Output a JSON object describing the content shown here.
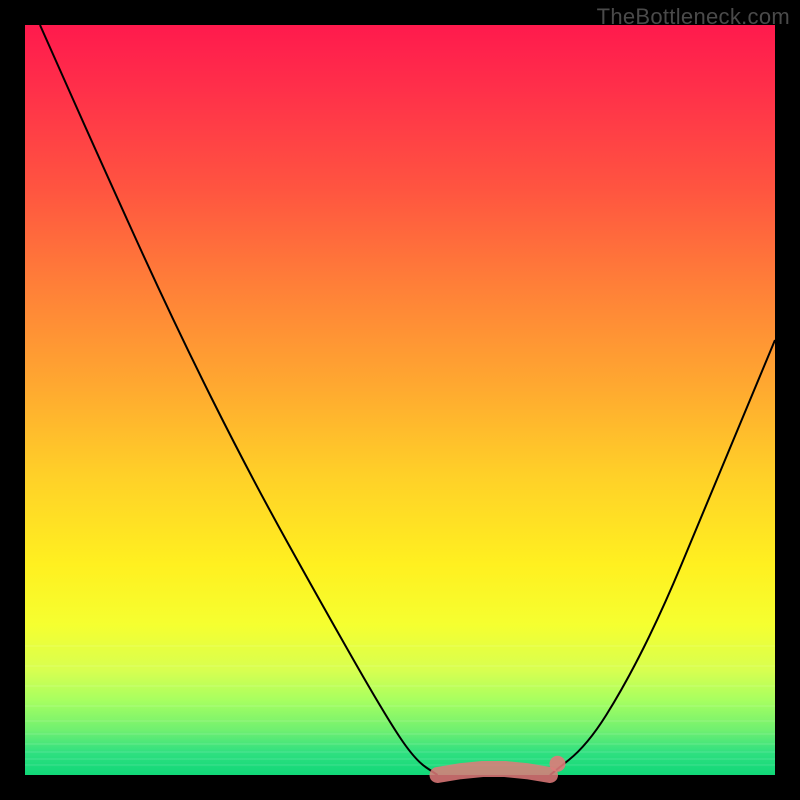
{
  "watermark": "TheBottleneck.com",
  "chart_data": {
    "type": "line",
    "title": "",
    "xlabel": "",
    "ylabel": "",
    "xlim": [
      0,
      100
    ],
    "ylim": [
      0,
      100
    ],
    "grid": false,
    "legend": false,
    "background_gradient_stops": [
      {
        "pos": 0,
        "color": "#ff1a4d"
      },
      {
        "pos": 22,
        "color": "#ff5540"
      },
      {
        "pos": 48,
        "color": "#ffa830"
      },
      {
        "pos": 72,
        "color": "#fff020"
      },
      {
        "pos": 90,
        "color": "#a8ff60"
      },
      {
        "pos": 100,
        "color": "#10d878"
      }
    ],
    "series": [
      {
        "name": "left-curve",
        "color": "#000000",
        "x": [
          2,
          10,
          20,
          30,
          40,
          48,
          52,
          55
        ],
        "y": [
          100,
          82,
          60,
          40,
          22,
          8,
          2,
          0
        ]
      },
      {
        "name": "right-curve",
        "color": "#000000",
        "x": [
          70,
          75,
          80,
          85,
          90,
          95,
          100
        ],
        "y": [
          0,
          4,
          12,
          22,
          34,
          46,
          58
        ]
      },
      {
        "name": "bottom-marker-band",
        "color": "#e07a7a",
        "x": [
          55,
          58,
          61,
          64,
          67,
          70
        ],
        "y": [
          0,
          0.5,
          0.8,
          0.8,
          0.5,
          0
        ]
      }
    ],
    "marker_dot": {
      "x": 71,
      "y": 1.5,
      "color": "#e07a7a"
    }
  }
}
